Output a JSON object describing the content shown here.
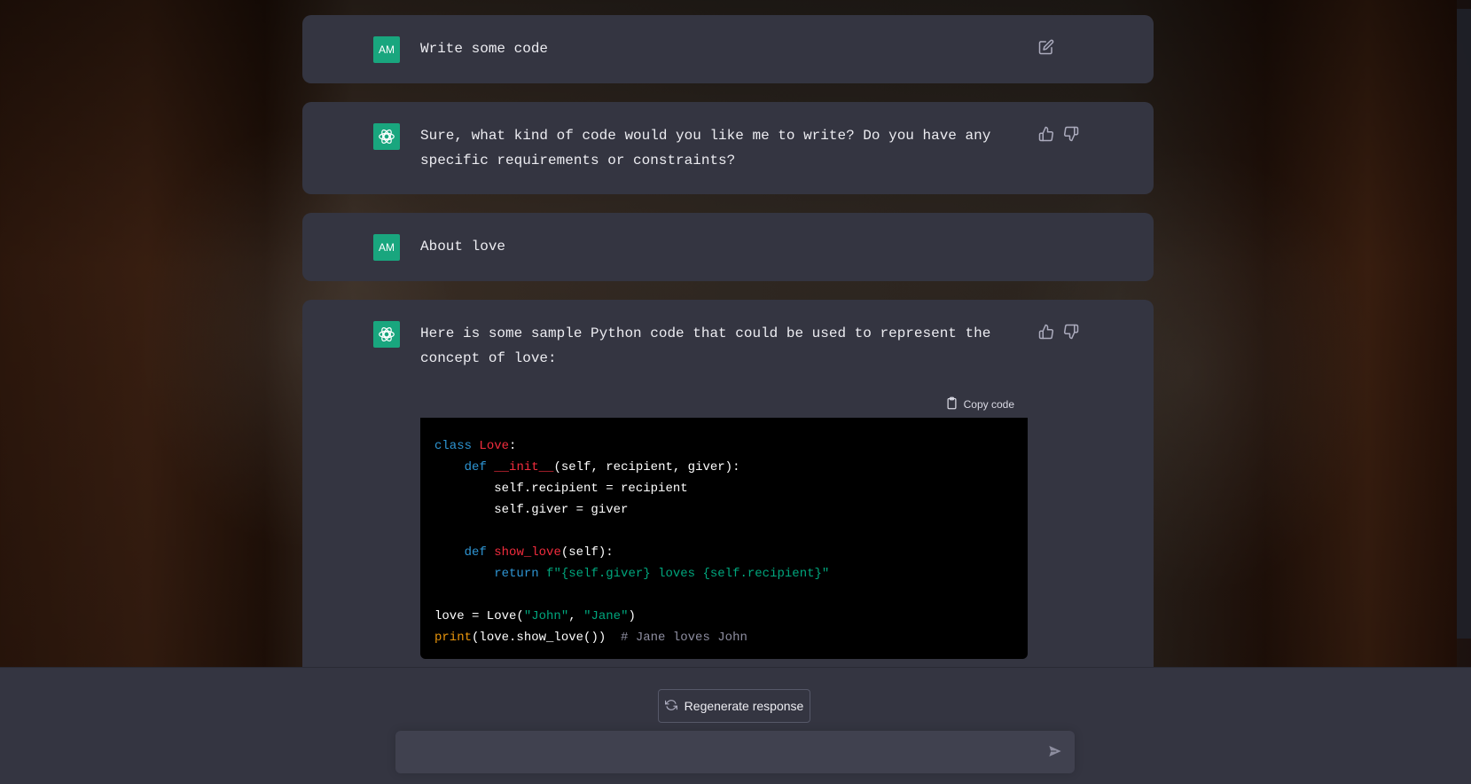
{
  "conversation": {
    "messages": [
      {
        "role": "user",
        "avatar": "AM",
        "text": "Write some code"
      },
      {
        "role": "assistant",
        "text": "Sure, what kind of code would you like me to write? Do you have any specific requirements or constraints?"
      },
      {
        "role": "user",
        "avatar": "AM",
        "text": "About love"
      },
      {
        "role": "assistant",
        "text": "Here is some sample Python code that could be used to represent the concept of love:"
      }
    ],
    "code_block": {
      "copy_label": "Copy code",
      "language": "python",
      "lines": [
        "class Love:",
        "    def __init__(self, recipient, giver):",
        "        self.recipient = recipient",
        "        self.giver = giver",
        "",
        "    def show_love(self):",
        "        return f\"{self.giver} loves {self.recipient}\"",
        "",
        "love = Love(\"John\", \"Jane\")",
        "print(love.show_love())  # Jane loves John"
      ]
    }
  },
  "footer": {
    "regenerate_label": "Regenerate response",
    "input_placeholder": ""
  },
  "icons": {
    "edit": "edit-icon",
    "thumbs_up": "thumbs-up-icon",
    "thumbs_down": "thumbs-down-icon",
    "clipboard": "clipboard-icon",
    "regenerate": "refresh-icon",
    "send": "send-icon",
    "assistant_logo": "openai-logo-icon"
  },
  "colors": {
    "card": "#343541",
    "avatar_green": "#19a67e",
    "input": "#40414f",
    "code_bg": "#000000"
  }
}
